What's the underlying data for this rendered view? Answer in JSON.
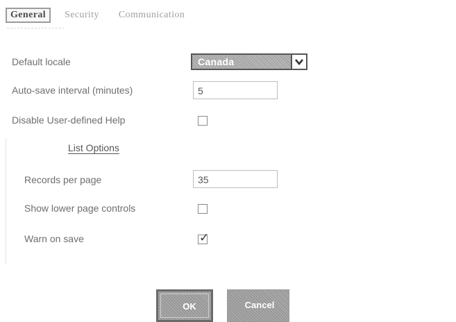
{
  "tabs": [
    {
      "label": "General",
      "active": true
    },
    {
      "label": "Security",
      "active": false
    },
    {
      "label": "Communication",
      "active": false
    }
  ],
  "fields": {
    "default_locale": {
      "label": "Default locale",
      "value": "Canada"
    },
    "autosave": {
      "label": "Auto-save interval (minutes)",
      "value": "5"
    },
    "disable_help": {
      "label": "Disable User-defined Help",
      "checked": false
    }
  },
  "list_options": {
    "title": "List Options",
    "records_per_page": {
      "label": "Records per page",
      "value": "35"
    },
    "show_lower_controls": {
      "label": "Show lower page controls",
      "checked": false
    },
    "warn_on_save": {
      "label": "Warn on save",
      "checked": true
    }
  },
  "buttons": {
    "ok": "OK",
    "cancel": "Cancel"
  },
  "icons": {
    "select_arrow": "chevron-down-icon",
    "checkmark": "checkmark-icon"
  }
}
